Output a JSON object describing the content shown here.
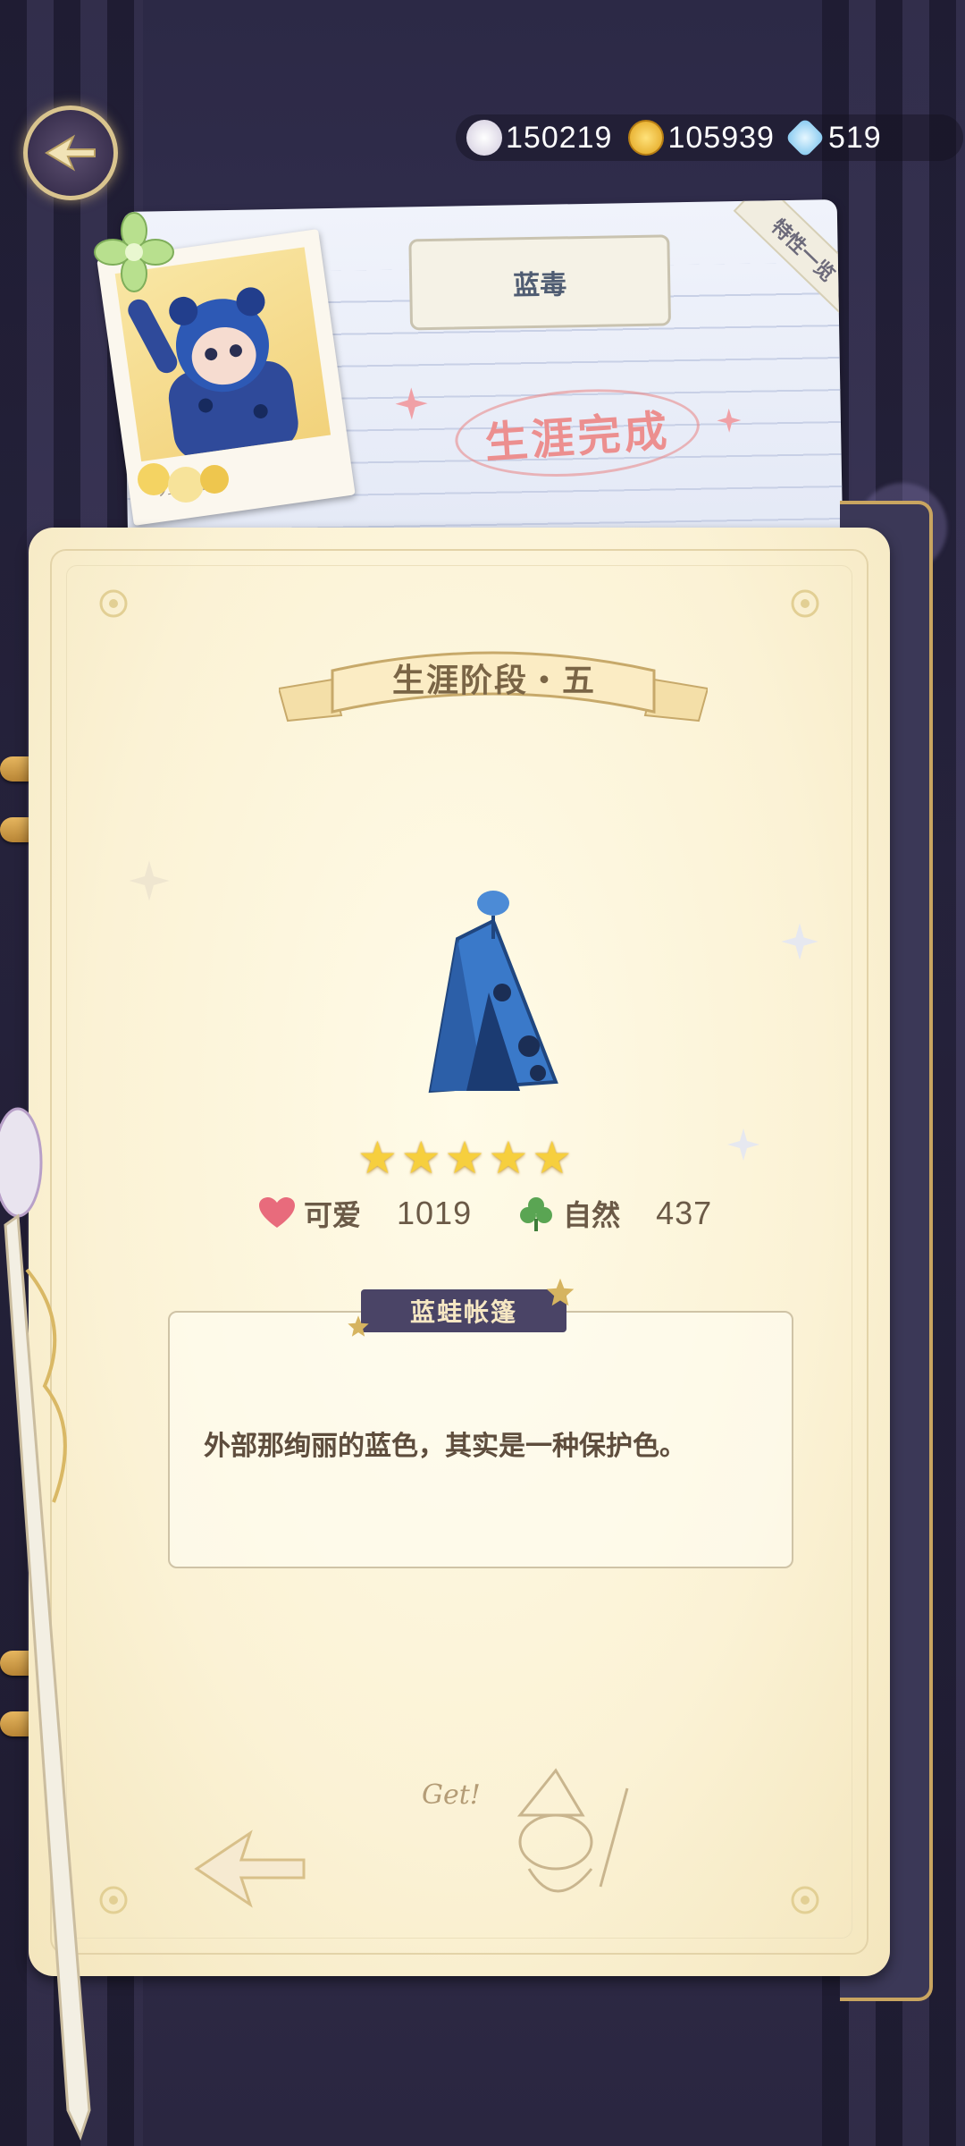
{
  "header": {
    "resources": [
      {
        "name": "shell-currency",
        "value": "150219",
        "color": "#e9e4ef"
      },
      {
        "name": "gold-coin",
        "value": "105939",
        "color": "#f2c23b"
      },
      {
        "name": "crystal-gem",
        "value": "519",
        "color": "#8fd0f5"
      }
    ]
  },
  "profile": {
    "character_name": "蓝毒",
    "status": "生涯完成",
    "traits_tab": "特性一览",
    "photo_caption": "ｳ14ﾊｼｭ"
  },
  "stage": {
    "title": "生涯阶段・五"
  },
  "item": {
    "rarity_stars": 5,
    "stars": [
      "★",
      "★",
      "★",
      "★",
      "★"
    ],
    "stats": [
      {
        "label": "可爱",
        "value": "1019",
        "icon": "heart-icon",
        "color": "#e86b7c"
      },
      {
        "label": "自然",
        "value": "437",
        "icon": "clover-icon",
        "color": "#5aa553"
      }
    ],
    "name": "蓝蛙帐篷",
    "description": "外部那绚丽的蓝色，其实是一种保护色。"
  },
  "decoration": {
    "doodle_text": "Get!"
  }
}
